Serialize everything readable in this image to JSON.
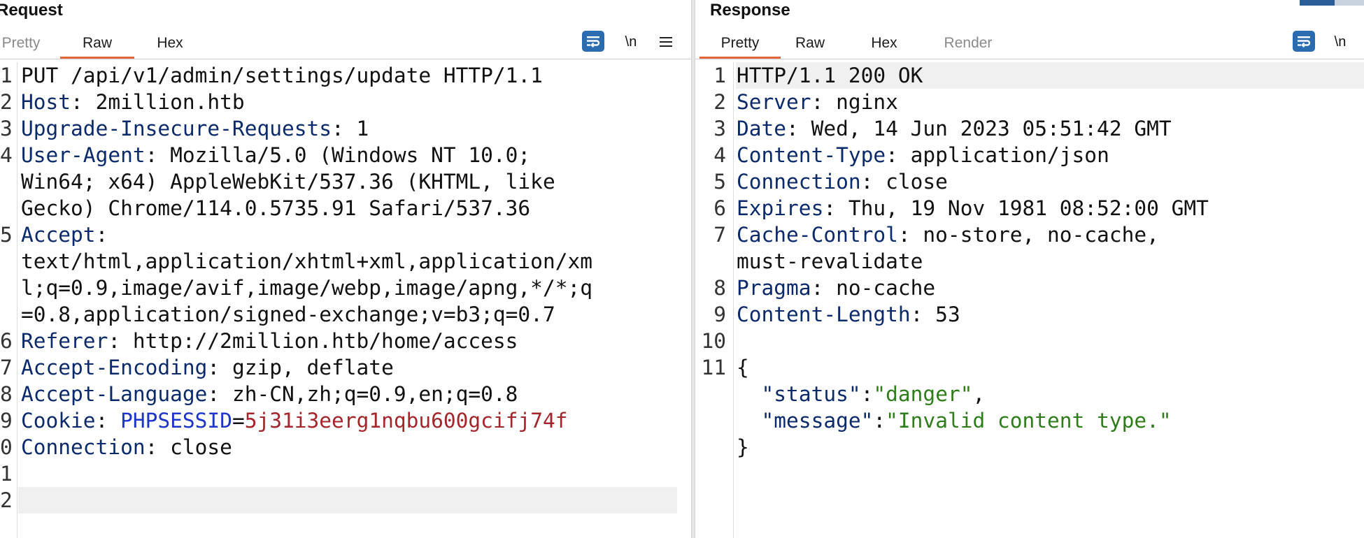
{
  "request": {
    "title": "Request",
    "tabs": [
      "Pretty",
      "Raw",
      "Hex"
    ],
    "active_tab": "Raw",
    "toolbar": {
      "newline_label": "\\n",
      "menu_icon": "hamburger-menu-icon",
      "wrap_icon": "word-wrap-icon"
    },
    "lines": [
      {
        "num": "1",
        "parts": [
          {
            "t": "PUT /api/v1/admin/settings/update HTTP/1.1",
            "c": ""
          }
        ]
      },
      {
        "num": "2",
        "parts": [
          {
            "t": "Host",
            "c": "k"
          },
          {
            "t": ": 2million.htb",
            "c": ""
          }
        ]
      },
      {
        "num": "3",
        "parts": [
          {
            "t": "Upgrade-Insecure-Requests",
            "c": "k"
          },
          {
            "t": ": 1",
            "c": ""
          }
        ]
      },
      {
        "num": "4",
        "parts": [
          {
            "t": "User-Agent",
            "c": "k"
          },
          {
            "t": ": Mozilla/5.0 (Windows NT 10.0;",
            "c": ""
          }
        ]
      },
      {
        "num": "",
        "parts": [
          {
            "t": "Win64; x64) AppleWebKit/537.36 (KHTML, like",
            "c": ""
          }
        ]
      },
      {
        "num": "",
        "parts": [
          {
            "t": "Gecko) Chrome/114.0.5735.91 Safari/537.36",
            "c": ""
          }
        ]
      },
      {
        "num": "5",
        "parts": [
          {
            "t": "Accept",
            "c": "k"
          },
          {
            "t": ":",
            "c": ""
          }
        ]
      },
      {
        "num": "",
        "parts": [
          {
            "t": "text/html,application/xhtml+xml,application/xm",
            "c": ""
          }
        ]
      },
      {
        "num": "",
        "parts": [
          {
            "t": "l;q=0.9,image/avif,image/webp,image/apng,*/*;q",
            "c": ""
          }
        ]
      },
      {
        "num": "",
        "parts": [
          {
            "t": "=0.8,application/signed-exchange;v=b3;q=0.7",
            "c": ""
          }
        ]
      },
      {
        "num": "6",
        "parts": [
          {
            "t": "Referer",
            "c": "k"
          },
          {
            "t": ": http://2million.htb/home/access",
            "c": ""
          }
        ]
      },
      {
        "num": "7",
        "parts": [
          {
            "t": "Accept-Encoding",
            "c": "k"
          },
          {
            "t": ": gzip, deflate",
            "c": ""
          }
        ]
      },
      {
        "num": "8",
        "parts": [
          {
            "t": "Accept-Language",
            "c": "k"
          },
          {
            "t": ": zh-CN,zh;q=0.9,en;q=0.8",
            "c": ""
          }
        ]
      },
      {
        "num": "9",
        "parts": [
          {
            "t": "Cookie",
            "c": "k"
          },
          {
            "t": ": ",
            "c": ""
          },
          {
            "t": "PHPSESSID",
            "c": "ck"
          },
          {
            "t": "=",
            "c": ""
          },
          {
            "t": "5j31i3eerg1nqbu600gcifj74f",
            "c": "cv"
          }
        ]
      },
      {
        "num": "0",
        "parts": [
          {
            "t": "Connection",
            "c": "k"
          },
          {
            "t": ": close",
            "c": ""
          }
        ]
      },
      {
        "num": "1",
        "parts": []
      },
      {
        "num": "2",
        "parts": [],
        "highlight": true
      }
    ]
  },
  "response": {
    "title": "Response",
    "tabs": [
      "Pretty",
      "Raw",
      "Hex",
      "Render"
    ],
    "active_tab": "Pretty",
    "toolbar": {
      "newline_label": "\\n",
      "wrap_icon": "word-wrap-icon"
    },
    "lines": [
      {
        "num": "1",
        "parts": [
          {
            "t": "HTTP/1.1 200 OK",
            "c": ""
          }
        ],
        "highlight": true
      },
      {
        "num": "2",
        "parts": [
          {
            "t": "Server",
            "c": "k"
          },
          {
            "t": ": nginx",
            "c": ""
          }
        ]
      },
      {
        "num": "3",
        "parts": [
          {
            "t": "Date",
            "c": "k"
          },
          {
            "t": ": Wed, 14 Jun 2023 05:51:42 GMT",
            "c": ""
          }
        ]
      },
      {
        "num": "4",
        "parts": [
          {
            "t": "Content-Type",
            "c": "k"
          },
          {
            "t": ": application/json",
            "c": ""
          }
        ]
      },
      {
        "num": "5",
        "parts": [
          {
            "t": "Connection",
            "c": "k"
          },
          {
            "t": ": close",
            "c": ""
          }
        ]
      },
      {
        "num": "6",
        "parts": [
          {
            "t": "Expires",
            "c": "k"
          },
          {
            "t": ": Thu, 19 Nov 1981 08:52:00 GMT",
            "c": ""
          }
        ]
      },
      {
        "num": "7",
        "parts": [
          {
            "t": "Cache-Control",
            "c": "k"
          },
          {
            "t": ": no-store, no-cache,",
            "c": ""
          }
        ]
      },
      {
        "num": "",
        "parts": [
          {
            "t": "must-revalidate",
            "c": ""
          }
        ]
      },
      {
        "num": "8",
        "parts": [
          {
            "t": "Pragma",
            "c": "k"
          },
          {
            "t": ": no-cache",
            "c": ""
          }
        ]
      },
      {
        "num": "9",
        "parts": [
          {
            "t": "Content-Length",
            "c": "k"
          },
          {
            "t": ": 53",
            "c": ""
          }
        ]
      },
      {
        "num": "10",
        "parts": []
      },
      {
        "num": "11",
        "parts": [
          {
            "t": "{",
            "c": ""
          }
        ]
      },
      {
        "num": "",
        "parts": [
          {
            "t": "  ",
            "c": ""
          },
          {
            "t": "\"status\"",
            "c": "jk"
          },
          {
            "t": ":",
            "c": ""
          },
          {
            "t": "\"danger\"",
            "c": "s"
          },
          {
            "t": ",",
            "c": ""
          }
        ]
      },
      {
        "num": "",
        "parts": [
          {
            "t": "  ",
            "c": ""
          },
          {
            "t": "\"message\"",
            "c": "jk"
          },
          {
            "t": ":",
            "c": ""
          },
          {
            "t": "\"Invalid content type.\"",
            "c": "s"
          }
        ]
      },
      {
        "num": "",
        "parts": [
          {
            "t": "}",
            "c": ""
          }
        ]
      }
    ]
  },
  "colors": {
    "accent_tab_underline": "#e0663d",
    "header_key": "#0b2a6b",
    "cookie_name": "#1d35c9",
    "cookie_value": "#a3262b",
    "json_string": "#2e7d1a",
    "wrap_button": "#2b6cb0"
  }
}
